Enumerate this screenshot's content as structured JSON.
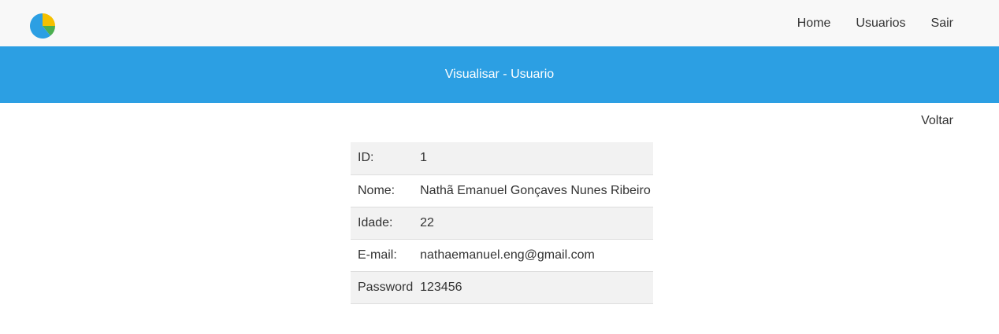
{
  "nav": {
    "logo_icon": "pie-chart-icon",
    "items": [
      {
        "label": "Home"
      },
      {
        "label": "Usuarios"
      },
      {
        "label": "Sair"
      }
    ]
  },
  "banner": {
    "title": "Visualisar - Usuario",
    "color": "#2c9fe3"
  },
  "back_label": "Voltar",
  "user": {
    "rows": [
      {
        "label": "ID:",
        "value": "1"
      },
      {
        "label": "Nome:",
        "value": "Nathã Emanuel Gonçaves Nunes Ribeiro"
      },
      {
        "label": "Idade:",
        "value": "22"
      },
      {
        "label": "E-mail:",
        "value": "nathaemanuel.eng@gmail.com"
      },
      {
        "label": "Password",
        "value": "123456"
      }
    ]
  }
}
